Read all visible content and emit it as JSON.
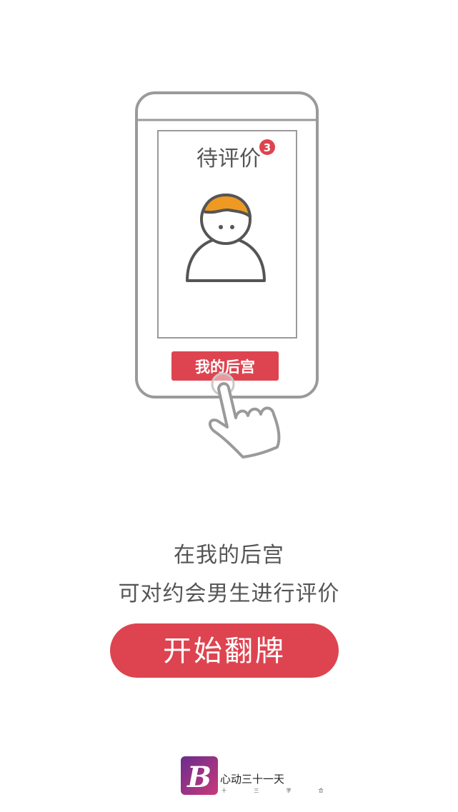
{
  "illustration": {
    "card_title": "待评价",
    "badge_count": "3",
    "phone_button_label": "我的后宫"
  },
  "description": {
    "line1": "在我的后宫",
    "line2": "可对约会男生进行评价"
  },
  "cta": {
    "label": "开始翻牌"
  },
  "brand": {
    "logo_letter": "B",
    "name": "心动三十一天",
    "sub": "十 三 字 合"
  },
  "colors": {
    "accent_red": "#dd4450",
    "avatar_hair": "#ee9a22",
    "outline_gray": "#999999",
    "text_gray": "#555555"
  }
}
